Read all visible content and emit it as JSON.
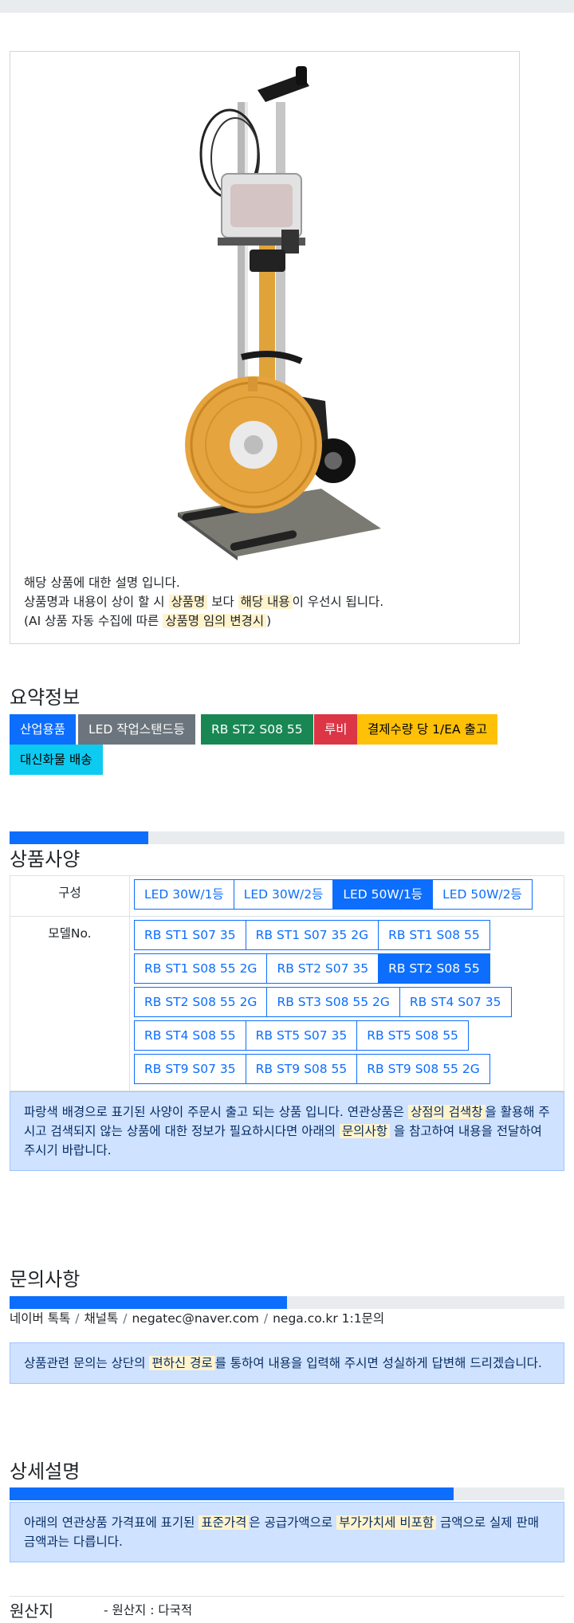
{
  "product": {
    "description": {
      "line1": "해당 상품에 대한 설명 입니다.",
      "line2_a": "상품명과 내용이 상이 할 시 ",
      "line2_hl1": "상품명",
      "line2_b": " 보다 ",
      "line2_hl2": "해당 내용",
      "line2_c": "이 우선시 됩니다.",
      "line3_a": "(AI 상품 자동 수집에 따른 ",
      "line3_hl": "상품명 임의 변경시",
      "line3_b": ")"
    }
  },
  "summary": {
    "title": "요약정보",
    "badges": [
      {
        "label": "산업용품",
        "color": "#0d6efd",
        "text_color": "#ffffff"
      },
      {
        "label": "LED 작업스탠드등",
        "color": "#6c757d",
        "text_color": "#ffffff"
      },
      {
        "label": "RB ST2 S08 55",
        "color": "#198754",
        "text_color": "#ffffff"
      },
      {
        "label": "루비",
        "color": "#dc3545",
        "text_color": "#ffffff"
      },
      {
        "label": "결제수량 당 1/EA 출고",
        "color": "#ffc107",
        "text_color": "#000000"
      },
      {
        "label": "대신화물 배송",
        "color": "#0dcaf0",
        "text_color": "#000000"
      }
    ]
  },
  "spec": {
    "title": "상품사양",
    "progress": 0.25,
    "composition_label": "구성",
    "composition_options": [
      {
        "label": "LED 30W/1등",
        "selected": false
      },
      {
        "label": "LED 30W/2등",
        "selected": false
      },
      {
        "label": "LED 50W/1등",
        "selected": true
      },
      {
        "label": "LED 50W/2등",
        "selected": false
      }
    ],
    "model_label": "모델No.",
    "model_rows": [
      [
        {
          "label": "RB ST1 S07 35",
          "selected": false
        },
        {
          "label": "RB ST1 S07 35 2G",
          "selected": false
        },
        {
          "label": "RB ST1 S08 55",
          "selected": false
        }
      ],
      [
        {
          "label": "RB ST1 S08 55 2G",
          "selected": false
        },
        {
          "label": "RB ST2 S07 35",
          "selected": false
        },
        {
          "label": "RB ST2 S08 55",
          "selected": true
        }
      ],
      [
        {
          "label": "RB ST2 S08 55 2G",
          "selected": false
        },
        {
          "label": "RB ST3 S08 55 2G",
          "selected": false
        },
        {
          "label": "RB ST4 S07 35",
          "selected": false
        }
      ],
      [
        {
          "label": "RB ST4 S08 55",
          "selected": false
        },
        {
          "label": "RB ST5 S07 35",
          "selected": false
        },
        {
          "label": "RB ST5 S08 55",
          "selected": false
        }
      ],
      [
        {
          "label": "RB ST9 S07 35",
          "selected": false
        },
        {
          "label": "RB ST9 S08 55",
          "selected": false
        },
        {
          "label": "RB ST9 S08 55 2G",
          "selected": false
        }
      ]
    ],
    "notice_a": "파랑색 배경으로 표기된 사양이 주문시 출고 되는 상품 입니다. 연관상품은 ",
    "notice_hl1": "상점의 검색창",
    "notice_b": "을 활용해 주시고 검색되지 않는 상품에 대한 정보가 필요하시다면 아래의 ",
    "notice_hl2": "문의사항",
    "notice_c": " 을 참고하여 내용을 전달하여 주시기 바랍니다."
  },
  "inquiry": {
    "title": "문의사항",
    "progress": 0.5,
    "channels": [
      "네이버 톡톡",
      "채널톡",
      "negatec@naver.com",
      "nega.co.kr 1:1문의"
    ],
    "notice_a": "상품관련 문의는 상단의 ",
    "notice_hl": "편하신 경로",
    "notice_b": "를 통하여 내용을 입력해 주시면 성실하게 답변해 드리겠습니다."
  },
  "detail": {
    "title": "상세설명",
    "progress": 0.8,
    "notice_a": "아래의 연관상품 가격표에 표기된 ",
    "notice_hl1": "표준가격",
    "notice_b": "은 공급가액으로 ",
    "notice_hl2": "부가가치세 비포함",
    "notice_c": " 금액으로 실제 판매금액과는 다릅니다."
  },
  "origin": {
    "label": "원산지",
    "value": "- 원산지 : 다국적"
  }
}
